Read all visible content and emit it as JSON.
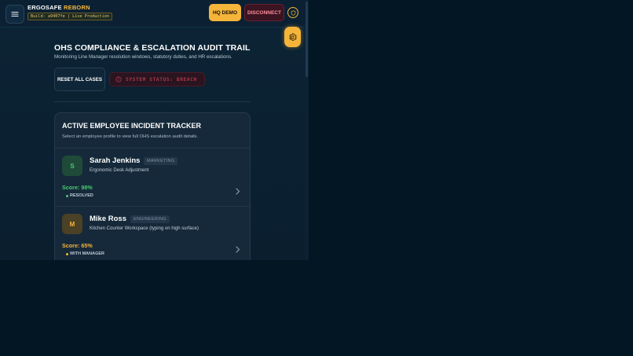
{
  "topbar": {
    "brand_primary": "ERGOSAFE",
    "brand_secondary": "REBORN",
    "build_label": "Build: a9407fe | Live Production",
    "hq_label": "HQ DEMO",
    "disconnect_label": "DISCONNECT",
    "icons": {
      "menu": "hamburger-icon",
      "shield": "shield-icon",
      "settings": "gear-icon"
    }
  },
  "header": {
    "title": "OHS COMPLIANCE & ESCALATION AUDIT TRAIL",
    "subtitle": "Monitoring Line Manager resolution windows, statutory duties, and HR escalations."
  },
  "actions": {
    "reset_label": "RESET ALL CASES",
    "status_label": "SYSTEM STATUS: BREACH"
  },
  "tracker": {
    "title": "ACTIVE EMPLOYEE INCIDENT TRACKER",
    "subtitle": "Select an employee profile to view full OHS escalation audit details.",
    "rows": [
      {
        "initial": "S",
        "name": "Sarah Jenkins",
        "department": "MARKETING",
        "description": "Ergonomic Desk Adjustment",
        "score": "Score: 98%",
        "status": "RESOLVED",
        "score_color": "#49c96f",
        "status_color": "#49c96f",
        "avatar_bg": "#1f4a3a",
        "avatar_color": "#49c96f"
      },
      {
        "initial": "M",
        "name": "Mike Ross",
        "department": "ENGINEERING",
        "description": "Kitchen Counter Workspace (typing on high surface)",
        "score": "Score: 65%",
        "status": "WITH MANAGER",
        "score_color": "#f5b43a",
        "status_color": "#f5b43a",
        "avatar_bg": "#4a4126",
        "avatar_color": "#f5b43a"
      }
    ]
  },
  "colors": {
    "accent": "#f5b43a",
    "danger": "#ff8d9c",
    "background": "#031624"
  }
}
